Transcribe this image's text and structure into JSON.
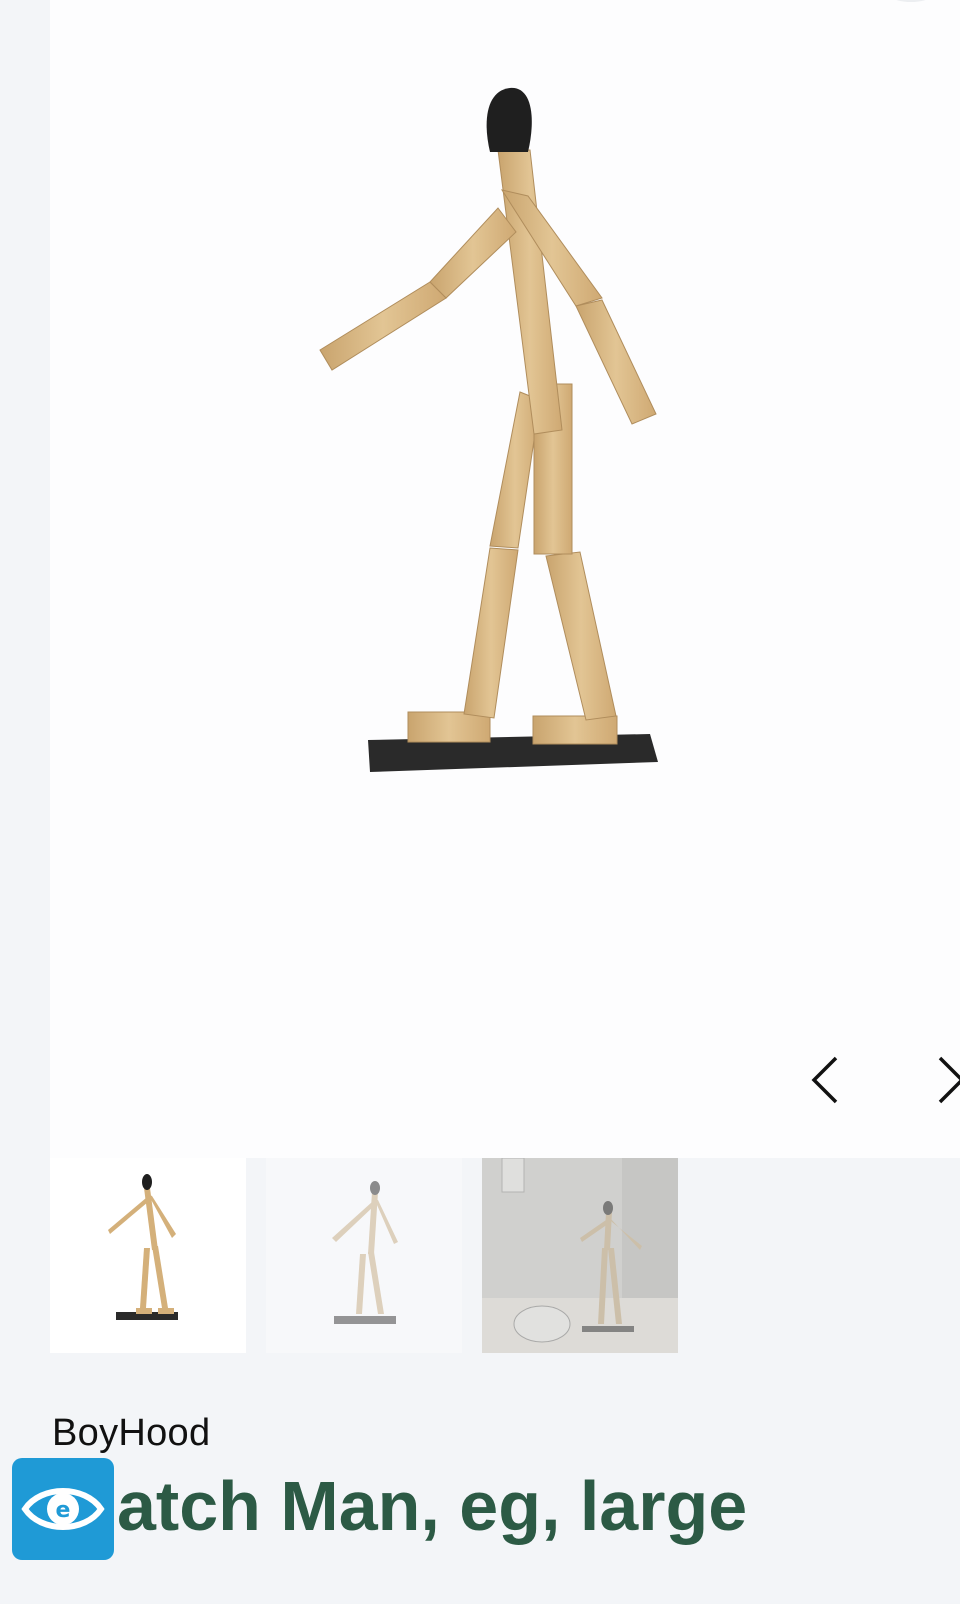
{
  "gallery": {
    "prev_icon": "chevron-left-icon",
    "next_icon": "chevron-right-icon",
    "thumbnails": [
      {
        "name": "thumbnail-1"
      },
      {
        "name": "thumbnail-2"
      },
      {
        "name": "thumbnail-3"
      }
    ]
  },
  "product": {
    "brand": "BoyHood",
    "title": "atch Man, eg, large"
  },
  "accessibility": {
    "icon": "eye-icon",
    "color": "#1f9ad6"
  },
  "colors": {
    "title": "#2c5a45",
    "wood": "#d9b98a",
    "base": "#2a2a2a"
  }
}
